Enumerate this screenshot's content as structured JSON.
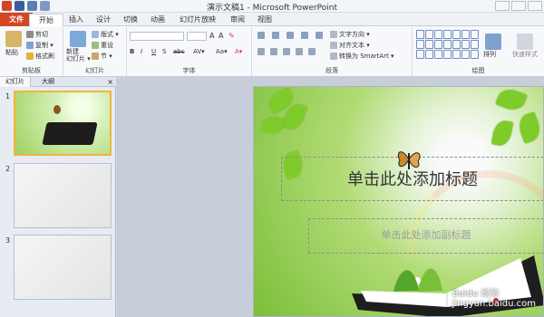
{
  "window": {
    "title": "演示文稿1 - Microsoft PowerPoint"
  },
  "tabs": [
    "文件",
    "开始",
    "插入",
    "设计",
    "切换",
    "动画",
    "幻灯片放映",
    "审阅",
    "视图"
  ],
  "ribbon": {
    "clipboard": {
      "label": "剪贴板",
      "paste": "粘贴",
      "cut": "剪切",
      "copy": "复制 ▾",
      "format_painter": "格式刷"
    },
    "slides": {
      "label": "幻灯片",
      "new_slide": "新建\n幻灯片 ▾",
      "layout": "版式 ▾",
      "reset": "重设",
      "section": "节 ▾"
    },
    "font": {
      "label": "字体",
      "font_name": "",
      "font_size": "",
      "buttons": [
        "B",
        "I",
        "U",
        "S",
        "abc",
        "AV▾",
        "Aa▾",
        "A▾"
      ]
    },
    "paragraph": {
      "label": "段落",
      "text_direction": "文字方向 ▾",
      "align_text": "对齐文本 ▾",
      "convert_smartart": "转换为 SmartArt ▾"
    },
    "drawing": {
      "label": "绘图",
      "arrange": "排列",
      "quick_styles": "快速样式"
    }
  },
  "pane": {
    "tabs": [
      "幻灯片",
      "大纲"
    ],
    "close": "×"
  },
  "thumbnails": [
    "1",
    "2",
    "3"
  ],
  "slide": {
    "title": "单击此处添加标题",
    "subtitle": "单击此处添加副标题"
  },
  "watermark": {
    "brand": "Baidu",
    "text": "经验",
    "url": "jingyan.baidu.com"
  }
}
